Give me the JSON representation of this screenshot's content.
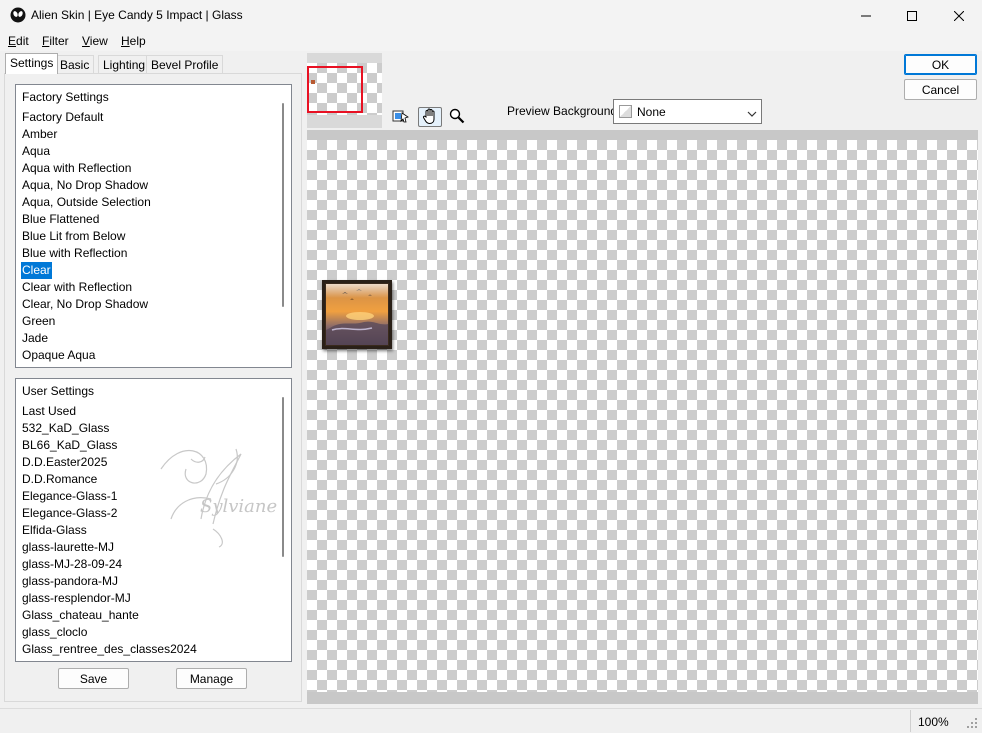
{
  "window": {
    "title": "Alien Skin | Eye Candy 5 Impact | Glass"
  },
  "menu": {
    "items": [
      {
        "key": "E",
        "rest": "dit"
      },
      {
        "key": "F",
        "rest": "ilter"
      },
      {
        "key": "V",
        "rest": "iew"
      },
      {
        "key": "H",
        "rest": "elp"
      }
    ]
  },
  "tabs": [
    "Settings",
    "Basic",
    "Lighting",
    "Bevel Profile"
  ],
  "factory": {
    "header": "Factory Settings",
    "items": [
      "Factory Default",
      "Amber",
      "Aqua",
      "Aqua with Reflection",
      "Aqua, No Drop Shadow",
      "Aqua, Outside Selection",
      "Blue Flattened",
      "Blue Lit from Below",
      "Blue with Reflection",
      "Clear",
      "Clear with Reflection",
      "Clear, No Drop Shadow",
      "Green",
      "Jade",
      "Opaque Aqua"
    ],
    "selected": "Clear"
  },
  "user": {
    "header": "User Settings",
    "items": [
      "Last Used",
      "532_KaD_Glass",
      "BL66_KaD_Glass",
      "D.D.Easter2025",
      "D.D.Romance",
      "Elegance-Glass-1",
      "Elegance-Glass-2",
      "Elfida-Glass",
      "glass-laurette-MJ",
      "glass-MJ-28-09-24",
      "glass-pandora-MJ",
      "glass-resplendor-MJ",
      "Glass_chateau_hante",
      "glass_cloclo",
      "Glass_rentree_des_classes2024"
    ],
    "watermark": "Sylviane"
  },
  "buttons": {
    "save": "Save",
    "manage": "Manage",
    "ok": "OK",
    "cancel": "Cancel"
  },
  "preview": {
    "background_label": "Preview Background:",
    "background_value": "None"
  },
  "status": {
    "zoom": "100%"
  },
  "colors": {
    "selection": "#0078d7",
    "navigator_frame": "#e81123"
  },
  "icons": [
    "app-alien-icon",
    "minimize-icon",
    "maximize-icon",
    "close-icon",
    "navigate-icon",
    "hand-icon",
    "zoom-icon",
    "chevron-down-icon",
    "resize-grip-icon"
  ]
}
